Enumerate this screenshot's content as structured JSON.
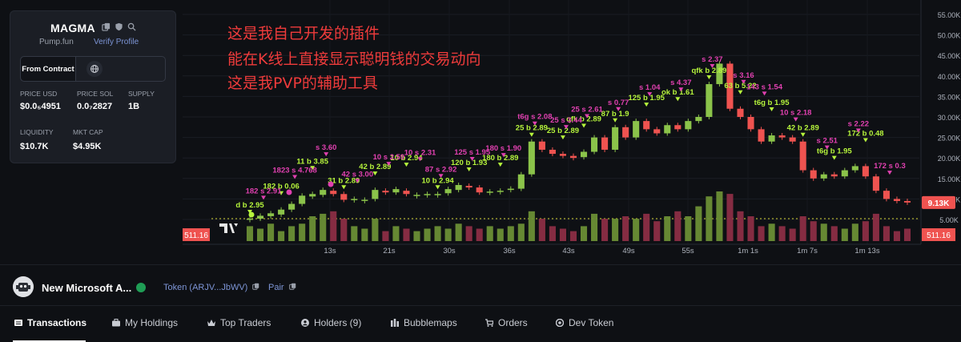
{
  "token": {
    "symbol": "MAGMA",
    "platform": "Pump.fun",
    "verify_label": "Verify Profile",
    "from_contract_label": "From Contract",
    "stats": {
      "price_usd_label": "PRICE USD",
      "price_usd": "$0.0₅4951",
      "price_sol_label": "PRICE SOL",
      "price_sol": "0.0₇2827",
      "supply_label": "SUPPLY",
      "supply": "1B",
      "liquidity_label": "LIQUIDITY",
      "liquidity": "$10.7K",
      "mktcap_label": "MKT CAP",
      "mktcap": "$4.95K"
    }
  },
  "overlay": {
    "line1": "这是我自己开发的插件",
    "line2": "能在K线上直接显示聪明钱的交易动向",
    "line3": "这是我PVP的辅助工具"
  },
  "chart": {
    "y_ticks": [
      "55.00K",
      "50.00K",
      "45.00K",
      "40.00K",
      "35.00K",
      "30.00K",
      "25.00K",
      "20.00K",
      "15.00K",
      "10.00K",
      "5.00K"
    ],
    "x_ticks": [
      "13s",
      "21s",
      "30s",
      "36s",
      "43s",
      "49s",
      "55s",
      "1m 1s",
      "1m 7s",
      "1m 13s"
    ],
    "price_tag": "9.13K",
    "volume_left_tag": "511.16",
    "volume_right_tag": "511.16",
    "colors": {
      "up": "#8bc34a",
      "down": "#ef5350",
      "buy_label": "#b6f53c",
      "sell_label": "#e040b0"
    },
    "buy_labels": [
      "d b 2.95",
      "182 b 0.06",
      "11 b 3.85",
      "31 b 2.89",
      "42 b 2.89",
      "10 b 2.94",
      "10 b 2.94",
      "120 b 1.93",
      "180 b 2.89",
      "25 b 2.89",
      "25 b 2.89",
      "qfk b 2.89",
      "87 b 1.9",
      "125 b 1.95",
      "ok b 1.61",
      "qfk b 2.89",
      "63 b 5.22",
      "t6g b 1.95",
      "42 b 2.89",
      "t6g b 1.95",
      "172 b 0.48"
    ],
    "sell_labels": [
      "182 s 2.91",
      "1823 s 4.768",
      "s 3.60",
      "42 s 3.00",
      "10 s 2.59",
      "10 s 2.31",
      "87 s 2.92",
      "125 s 1.95",
      "180 s 1.90",
      "t6g s 2.08",
      "25 s 3.44",
      "25 s 2.61",
      "s 0.77",
      "s 1.04",
      "s 4.37",
      "s 2.37",
      "s 3.16",
      "143 s 1.54",
      "10 s 2.18",
      "s 2.51",
      "s 2.22",
      "172 s 0.3"
    ],
    "candles": [
      [
        5.0,
        5.2
      ],
      [
        5.2,
        5.9
      ],
      [
        5.8,
        6.5
      ],
      [
        6.2,
        7.4
      ],
      [
        7.4,
        8.8
      ],
      [
        8.8,
        10.8
      ],
      [
        10.6,
        11.2
      ],
      [
        11.0,
        12.2
      ],
      [
        12.0,
        11.2
      ],
      [
        11.2,
        9.8
      ],
      [
        10.0,
        10.0
      ],
      [
        9.8,
        9.8
      ],
      [
        10.0,
        12.2
      ],
      [
        12.0,
        11.6
      ],
      [
        11.6,
        12.4
      ],
      [
        12.0,
        11.2
      ],
      [
        11.0,
        11.0
      ],
      [
        11.2,
        11.2
      ],
      [
        11.2,
        11.2
      ],
      [
        11.4,
        12.4
      ],
      [
        12.2,
        13.4
      ],
      [
        13.2,
        12.8
      ],
      [
        12.8,
        11.6
      ],
      [
        11.8,
        11.8
      ],
      [
        12.0,
        12.0
      ],
      [
        12.2,
        12.5
      ],
      [
        12.5,
        16.0
      ],
      [
        16.0,
        24.0
      ],
      [
        24.0,
        22.0
      ],
      [
        22.0,
        21.0
      ],
      [
        21.0,
        20.5
      ],
      [
        20.5,
        20.0
      ],
      [
        20.2,
        21.5
      ],
      [
        21.5,
        25.0
      ],
      [
        25.0,
        22.0
      ],
      [
        22.0,
        27.5
      ],
      [
        27.5,
        25.0
      ],
      [
        25.0,
        29.0
      ],
      [
        29.0,
        27.0
      ],
      [
        27.0,
        26.0
      ],
      [
        26.0,
        28.0
      ],
      [
        28.0,
        27.0
      ],
      [
        27.0,
        29.0
      ],
      [
        29.0,
        30.0
      ],
      [
        30.0,
        38.0
      ],
      [
        38.0,
        43.0
      ],
      [
        43.0,
        32.0
      ],
      [
        32.0,
        30.0
      ],
      [
        30.0,
        27.0
      ],
      [
        27.0,
        24.0
      ],
      [
        24.0,
        25.5
      ],
      [
        25.5,
        25.0
      ],
      [
        25.0,
        24.0
      ],
      [
        24.0,
        17.0
      ],
      [
        17.0,
        15.0
      ],
      [
        15.0,
        16.0
      ],
      [
        16.0,
        15.5
      ],
      [
        15.5,
        17.0
      ],
      [
        17.0,
        18.0
      ],
      [
        18.0,
        15.5
      ],
      [
        15.5,
        12.0
      ],
      [
        12.0,
        10.0
      ],
      [
        10.0,
        9.5
      ],
      [
        9.5,
        9.13
      ]
    ],
    "volumes": [
      0.3,
      0.25,
      0.35,
      0.2,
      0.3,
      0.35,
      0.5,
      0.55,
      0.6,
      0.45,
      0.3,
      0.25,
      0.45,
      0.2,
      0.3,
      0.25,
      0.2,
      0.25,
      0.3,
      0.25,
      0.35,
      0.3,
      0.25,
      0.3,
      0.25,
      0.3,
      0.35,
      0.6,
      0.45,
      0.3,
      0.25,
      0.2,
      0.3,
      0.55,
      0.45,
      0.45,
      0.5,
      0.45,
      0.55,
      0.4,
      0.5,
      0.6,
      0.5,
      0.7,
      0.9,
      1.0,
      0.95,
      0.6,
      0.5,
      0.3,
      0.35,
      0.3,
      0.25,
      0.5,
      0.4,
      0.35,
      0.3,
      0.25,
      0.35,
      0.4,
      0.55,
      0.3,
      0.2,
      0.25
    ]
  },
  "pair": {
    "name": "New Microsoft A...",
    "token_link": "Token (ARJV...JbWV)",
    "pair_link": "Pair"
  },
  "tabs": [
    {
      "label": "Transactions",
      "icon": "list-icon"
    },
    {
      "label": "My Holdings",
      "icon": "briefcase-icon"
    },
    {
      "label": "Top Traders",
      "icon": "crown-icon"
    },
    {
      "label": "Holders (9)",
      "icon": "users-icon"
    },
    {
      "label": "Bubblemaps",
      "icon": "bars-icon"
    },
    {
      "label": "Orders",
      "icon": "cart-icon"
    },
    {
      "label": "Dev Token",
      "icon": "coin-icon"
    }
  ]
}
